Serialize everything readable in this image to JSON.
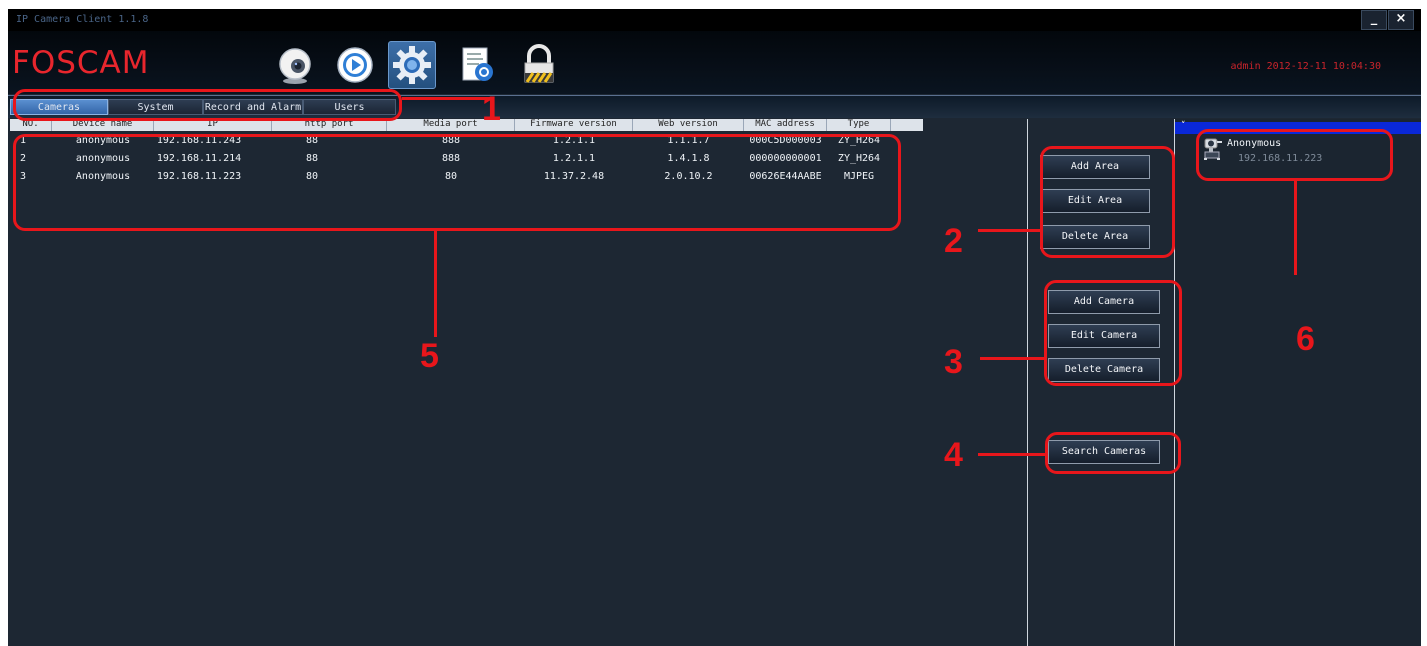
{
  "window": {
    "title": "IP Camera Client 1.1.8",
    "minimize_label": "_",
    "close_label": "×"
  },
  "header": {
    "logo": "FOSCAM",
    "status": "admin  2012-12-11  10:04:30",
    "toolbar": [
      {
        "name": "live-video",
        "icon": "webcam-icon"
      },
      {
        "name": "playback",
        "icon": "play-icon"
      },
      {
        "name": "settings",
        "icon": "gear-icon",
        "active": true
      },
      {
        "name": "log",
        "icon": "document-icon"
      },
      {
        "name": "lock",
        "icon": "lock-icon"
      }
    ]
  },
  "tabs": [
    {
      "label": "Cameras",
      "active": true
    },
    {
      "label": "System"
    },
    {
      "label": "Record and Alarm"
    },
    {
      "label": "Users"
    }
  ],
  "table": {
    "columns": [
      "NO.",
      "Device name",
      "IP",
      "http port",
      "Media port",
      "Firmware version",
      "Web version",
      "MAC address",
      "Type"
    ],
    "rows": [
      [
        "1",
        "anonymous",
        "192.168.11.243",
        "88",
        "888",
        "1.2.1.1",
        "1.1.1.7",
        "000C5D000003",
        "ZY_H264"
      ],
      [
        "2",
        "anonymous",
        "192.168.11.214",
        "88",
        "888",
        "1.2.1.1",
        "1.4.1.8",
        "000000000001",
        "ZY_H264"
      ],
      [
        "3",
        "Anonymous",
        "192.168.11.223",
        "80",
        "80",
        "11.37.2.48",
        "2.0.10.2",
        "00626E44AABE",
        "MJPEG"
      ]
    ]
  },
  "area_buttons": {
    "add": "Add Area",
    "edit": "Edit Area",
    "delete": "Delete Area"
  },
  "camera_buttons": {
    "add": "Add Camera",
    "edit": "Edit Camera",
    "delete": "Delete Camera",
    "search": "Search Cameras"
  },
  "tree": {
    "group": "",
    "camera_name": "Anonymous",
    "camera_ip": "192.168.11.223"
  },
  "annotations": [
    "1",
    "2",
    "3",
    "4",
    "5",
    "6"
  ],
  "colors": {
    "annotation": "#e8161b",
    "logo": "#e8262d",
    "tree_selected": "#0a28d8",
    "background": "#1d2733"
  }
}
